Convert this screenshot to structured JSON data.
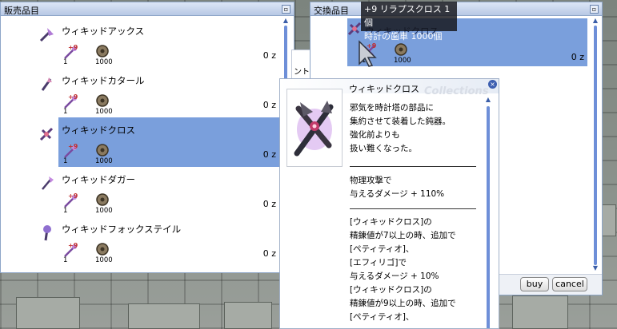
{
  "shop_window": {
    "title": "販売品目",
    "items": [
      {
        "name": "ウィキッドアックス",
        "mat1_plus": "+9",
        "mat1_qty": "1",
        "mat2_qty": "1000",
        "price": "0 z",
        "selected": false
      },
      {
        "name": "ウィキッドカタール",
        "mat1_plus": "+9",
        "mat1_qty": "1",
        "mat2_qty": "1000",
        "price": "0 z",
        "selected": false
      },
      {
        "name": "ウィキッドクロス",
        "mat1_plus": "+9",
        "mat1_qty": "1",
        "mat2_qty": "1000",
        "price": "0 z",
        "selected": true
      },
      {
        "name": "ウィキッドダガー",
        "mat1_plus": "+9",
        "mat1_qty": "1",
        "mat2_qty": "1000",
        "price": "0 z",
        "selected": false
      },
      {
        "name": "ウィキッドフォックステイル",
        "mat1_plus": "+9",
        "mat1_qty": "1",
        "mat2_qty": "1000",
        "price": "0 z",
        "selected": false
      }
    ]
  },
  "exchange_window": {
    "title": "交換品目",
    "item": {
      "name": "ウィキッドクロス",
      "mat1_plus": "+9",
      "mat1_qty": "1",
      "mat2_qty": "1000",
      "price": "0 z"
    },
    "buy_label": "buy",
    "cancel_label": "cancel"
  },
  "partial_text": "ント、",
  "tooltip": {
    "line1": "+9 リラプスクロス 1個",
    "line2": "時計の歯車 1000個"
  },
  "item_detail": {
    "name": "ウィキッドクロス",
    "watermark": "Collections",
    "description": [
      "邪気を時計塔の部品に",
      "集約させて装着した鈍器。",
      "強化前よりも",
      "扱い難くなった。"
    ],
    "effects_1": [
      "物理攻撃で",
      "与えるダメージ + 110%"
    ],
    "effects_2": [
      "[ウィキッドクロス]の",
      "精錬値が7以上の時、追加で",
      "[ペティティオ]、",
      "[エフィリゴ]で",
      "与えるダメージ + 10%",
      "[ウィキッドクロス]の",
      "精錬値が9以上の時、追加で",
      "[ペティティオ]、"
    ]
  },
  "colors": {
    "selection": "#7a9fdc",
    "titlebar": "#c6d4ec",
    "scrollbar": "#6e8fd8"
  }
}
